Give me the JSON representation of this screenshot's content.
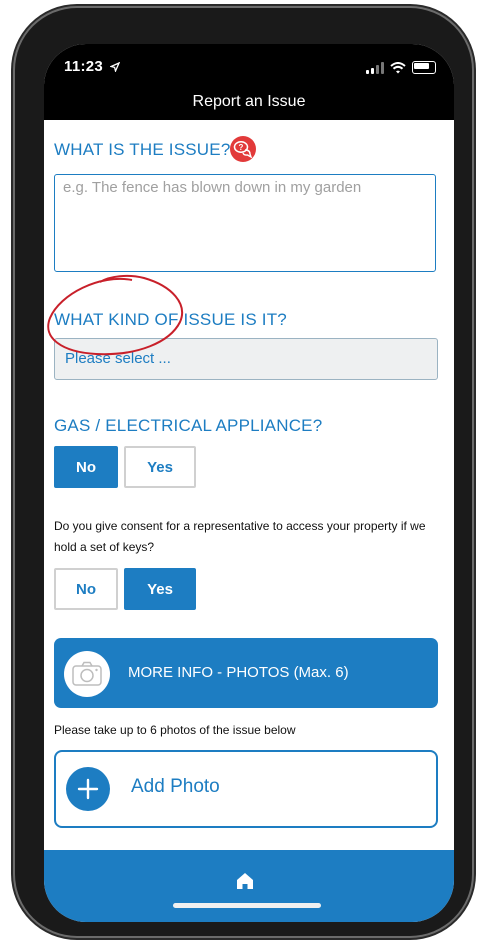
{
  "status_bar": {
    "time": "11:23"
  },
  "nav": {
    "title": "Report an Issue"
  },
  "issue": {
    "title": "WHAT IS THE ISSUE?",
    "placeholder": "e.g. The fence has blown down in my garden"
  },
  "kind": {
    "title": "WHAT KIND OF ISSUE IS IT?",
    "select_value": "Please select ..."
  },
  "gas": {
    "title": "GAS / ELECTRICAL APPLIANCE?",
    "no_label": "No",
    "yes_label": "Yes",
    "selected": "No"
  },
  "consent": {
    "question": "Do you give consent for a representative to access your property if we hold a set of keys?",
    "no_label": "No",
    "yes_label": "Yes",
    "selected": "Yes"
  },
  "photos": {
    "banner_label": "MORE INFO - PHOTOS (Max. 6)",
    "hint": "Please take up to 6 photos of the issue below",
    "add_label": "Add Photo"
  },
  "colors": {
    "accent": "#1d7dc2",
    "help_icon": "#e23a3a",
    "annotation": "#c8202a"
  },
  "icons": {
    "help": "chat-bubbles-question-icon",
    "camera": "camera-icon",
    "add": "plus-icon",
    "home": "home-icon",
    "location": "location-arrow-icon"
  }
}
